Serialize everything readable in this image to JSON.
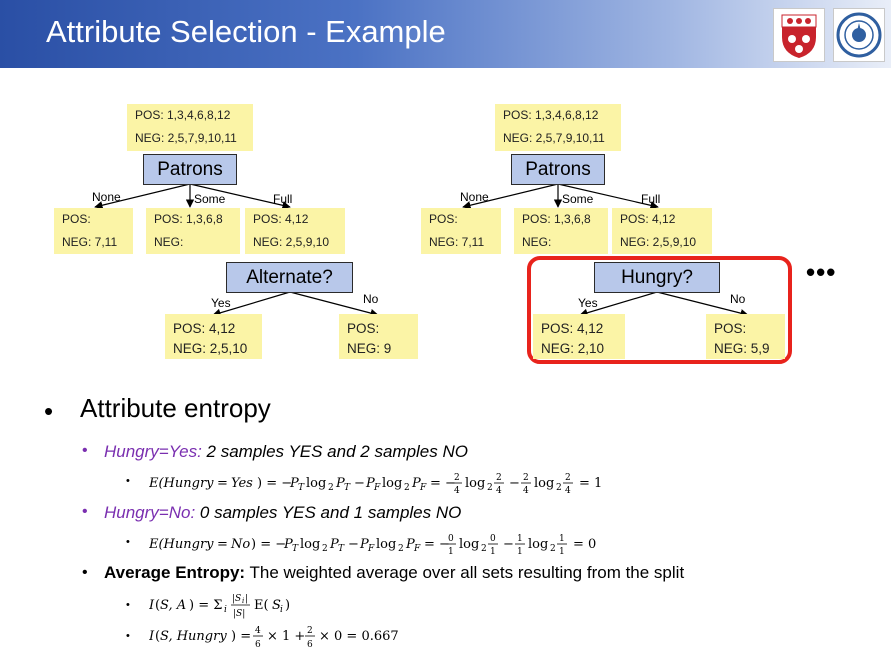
{
  "title": "Attribute Selection - Example",
  "logos": [
    "crest-logo",
    "seal-logo"
  ],
  "left_tree": {
    "root": {
      "pos": "POS: 1,3,4,6,8,12",
      "neg": "NEG: 2,5,7,9,10,11"
    },
    "root_node": "Patrons",
    "branches": [
      "None",
      "Some",
      "Full"
    ],
    "children": [
      {
        "pos": "POS:",
        "neg": "NEG: 7,11"
      },
      {
        "pos": "POS: 1,3,6,8",
        "neg": "NEG:"
      },
      {
        "pos": "POS: 4,12",
        "neg": "NEG: 2,5,9,10"
      }
    ],
    "sub_node": "Alternate?",
    "sub_branches": [
      "Yes",
      "No"
    ],
    "sub_children": [
      {
        "pos": "POS: 4,12",
        "neg": "NEG: 2,5,10"
      },
      {
        "pos": "POS:",
        "neg": "NEG: 9"
      }
    ]
  },
  "right_tree": {
    "root": {
      "pos": "POS: 1,3,4,6,8,12",
      "neg": "NEG: 2,5,7,9,10,11"
    },
    "root_node": "Patrons",
    "branches": [
      "None",
      "Some",
      "Full"
    ],
    "children": [
      {
        "pos": "POS:",
        "neg": "NEG: 7,11"
      },
      {
        "pos": "POS: 1,3,6,8",
        "neg": "NEG:"
      },
      {
        "pos": "POS: 4,12",
        "neg": "NEG: 2,5,9,10"
      }
    ],
    "sub_node": "Hungry?",
    "sub_branches": [
      "Yes",
      "No"
    ],
    "sub_children": [
      {
        "pos": "POS: 4,12",
        "neg": "NEG: 2,10"
      },
      {
        "pos": "POS:",
        "neg": "NEG: 5,9"
      }
    ]
  },
  "ellipsis": "•••",
  "content": {
    "heading": "Attribute entropy",
    "hungry_yes_label": "Hungry=Yes:",
    "hungry_yes_text": "2 samples YES and 2 samples NO",
    "hungry_yes_formula": "E(Hungry = Yes) = −P_T log₂ P_T − P_F log₂ P_F = −2/4 log₂ 2/4 − 2/4 log₂ 2/4 = 1",
    "hungry_no_label": "Hungry=No:",
    "hungry_no_text": "0 samples YES and 1 samples NO",
    "hungry_no_formula": "E(Hungry = No) = −P_T log₂ P_T − P_F log₂ P_F = −0/1 log₂ 0/1 − 1/1 log₂ 1/1 = 0",
    "avg_label": "Average Entropy:",
    "avg_text": "The weighted average over all sets resulting from the split",
    "avg_formula": "I(S, A) = Σ_i |S_i|/|S| E(S_i)",
    "avg_result": "I(S, Hungry) = 4/6 × 1 + 2/6 × 0 = 0.667"
  }
}
